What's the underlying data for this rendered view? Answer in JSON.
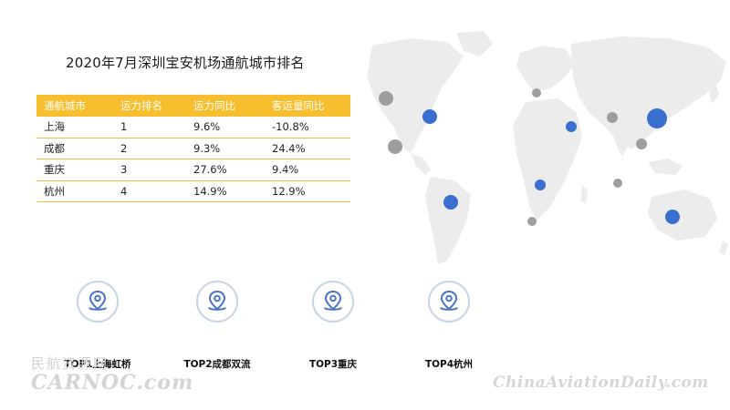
{
  "title": "2020年7月深圳宝安机场通航城市排名",
  "table": {
    "headers": [
      "通航城市",
      "运力排名",
      "运力同比",
      "客运量同比"
    ],
    "rows": [
      [
        "上海",
        "1",
        "9.6%",
        "-10.8%"
      ],
      [
        "成都",
        "2",
        "9.3%",
        "24.4%"
      ],
      [
        "重庆",
        "3",
        "27.6%",
        "9.4%"
      ],
      [
        "杭州",
        "4",
        "14.9%",
        "12.9%"
      ]
    ]
  },
  "tops": [
    {
      "label": "TOP1上海虹桥"
    },
    {
      "label": "TOP2成都双流"
    },
    {
      "label": "TOP3重庆"
    },
    {
      "label": "TOP4杭州"
    }
  ],
  "watermarks": {
    "left_cn": "民航资源网",
    "left_en": "CARNOC.com",
    "right": "ChinaAviationDaily.com"
  },
  "colors": {
    "header_bg": "#f7bf2e",
    "blue_dot": "#3a6fcf",
    "gray_dot": "#9e9e9e",
    "map_land": "#ececec",
    "pin": "#4b74c2"
  }
}
